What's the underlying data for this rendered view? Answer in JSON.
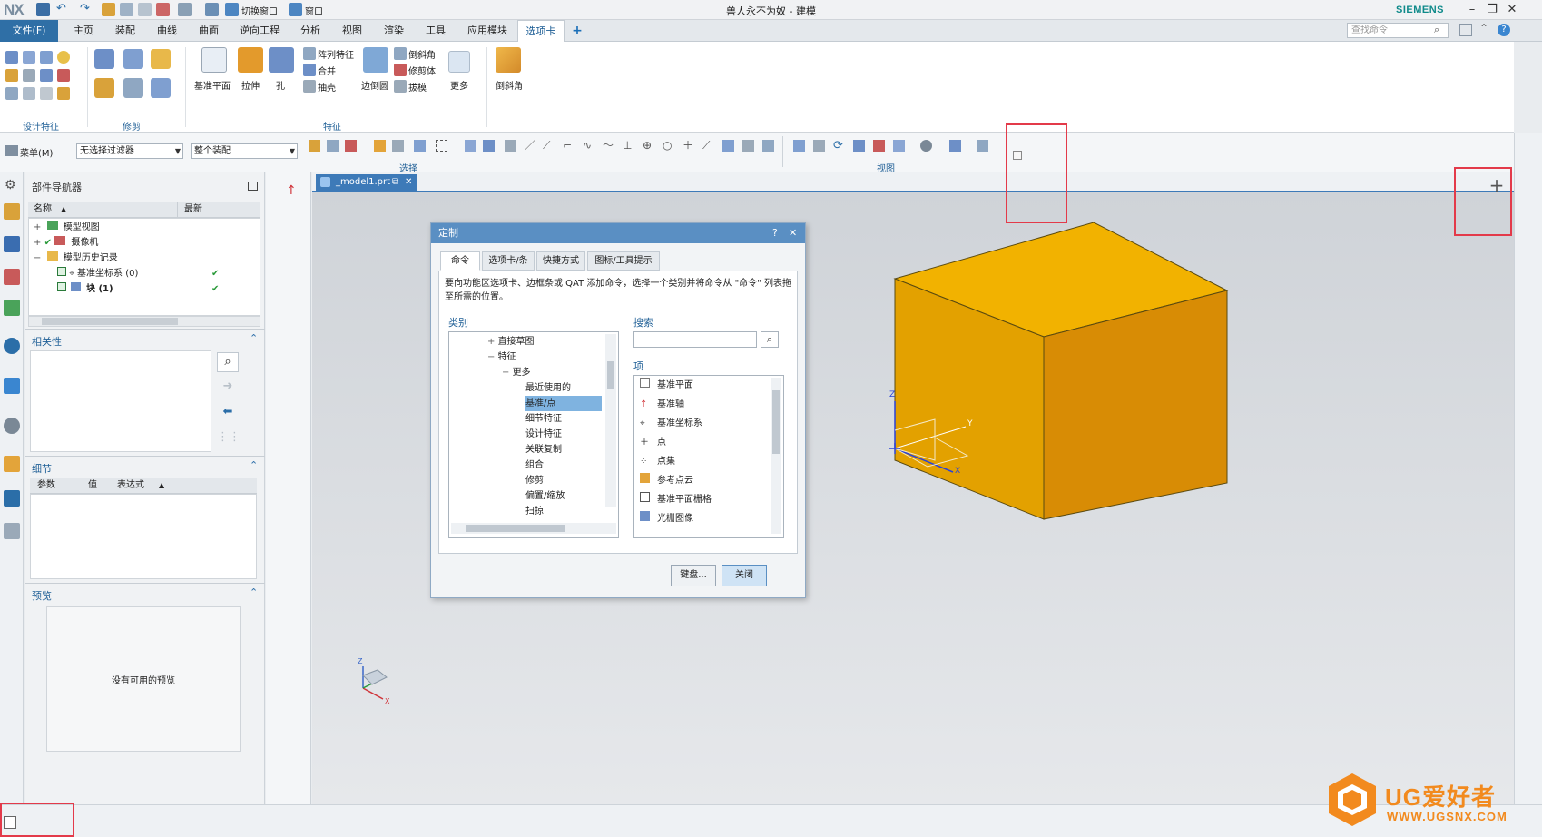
{
  "window": {
    "title": "兽人永不为奴 - 建模",
    "brand": "SIEMENS",
    "logo": "NX",
    "qat": {
      "switch_window": "切换窗口",
      "window": "窗口"
    }
  },
  "menubar": {
    "file": "文件(F)",
    "tabs": [
      "主页",
      "装配",
      "曲线",
      "曲面",
      "逆向工程",
      "分析",
      "视图",
      "渲染",
      "工具",
      "应用模块",
      "选项卡"
    ],
    "add_tab": "+",
    "search_placeholder": "查找命令"
  },
  "ribbon": {
    "groups": {
      "design_feature": "设计特征",
      "trim": "修剪",
      "feature": "特征"
    },
    "buttons": {
      "datum_plane": "基准平面",
      "extrude": "拉伸",
      "hole": "孔",
      "pattern_feature": "阵列特征",
      "unite": "合并",
      "shell": "抽壳",
      "edge_blend": "边倒圆",
      "chamfer": "倒斜角",
      "trim_body": "修剪体",
      "draft": "拔模",
      "more": "更多",
      "chamfer2": "倒斜角"
    }
  },
  "toolbar": {
    "menu": "菜单(M)",
    "filter": "无选择过滤器",
    "scope": "整个装配",
    "select_label": "选择",
    "view_label": "视图"
  },
  "navigator": {
    "title": "部件导航器",
    "col_name": "名称",
    "col_latest": "最新",
    "rows": [
      {
        "label": "模型视图"
      },
      {
        "label": "摄像机"
      },
      {
        "label": "模型历史记录"
      },
      {
        "label": "基准坐标系 (0)"
      },
      {
        "label": "块 (1)"
      }
    ],
    "dependencies": "相关性",
    "details": "细节",
    "details_cols": [
      "参数",
      "值",
      "表达式"
    ],
    "preview": "预览",
    "no_preview": "没有可用的预览"
  },
  "document": {
    "tab": "_model1.prt"
  },
  "dialog": {
    "title": "定制",
    "help": "?",
    "close_x": "✕",
    "tabs": [
      "命令",
      "选项卡/条",
      "快捷方式",
      "图标/工具提示"
    ],
    "instructions": "要向功能区选项卡、边框条或 QAT 添加命令，选择一个类别并将命令从 \"命令\" 列表拖至所需的位置。",
    "category_label": "类别",
    "categories": [
      {
        "label": "直接草图"
      },
      {
        "label": "特征"
      },
      {
        "label": "更多"
      },
      {
        "label": "最近使用的"
      },
      {
        "label": "基准/点"
      },
      {
        "label": "细节特征"
      },
      {
        "label": "设计特征"
      },
      {
        "label": "关联复制"
      },
      {
        "label": "组合"
      },
      {
        "label": "修剪"
      },
      {
        "label": "偏置/缩放"
      },
      {
        "label": "扫掠"
      }
    ],
    "search_label": "搜索",
    "items_label": "项",
    "items": [
      {
        "label": "基准平面"
      },
      {
        "label": "基准轴"
      },
      {
        "label": "基准坐标系"
      },
      {
        "label": "点"
      },
      {
        "label": "点集"
      },
      {
        "label": "参考点云"
      },
      {
        "label": "基准平面栅格"
      },
      {
        "label": "光栅图像"
      }
    ],
    "keyboard_btn": "键盘...",
    "close_btn": "关闭"
  },
  "axes": {
    "x": "X",
    "y": "Y",
    "z": "Z"
  },
  "watermark": {
    "text": "UG爱好者",
    "url": "WWW.UGSNX.COM"
  }
}
